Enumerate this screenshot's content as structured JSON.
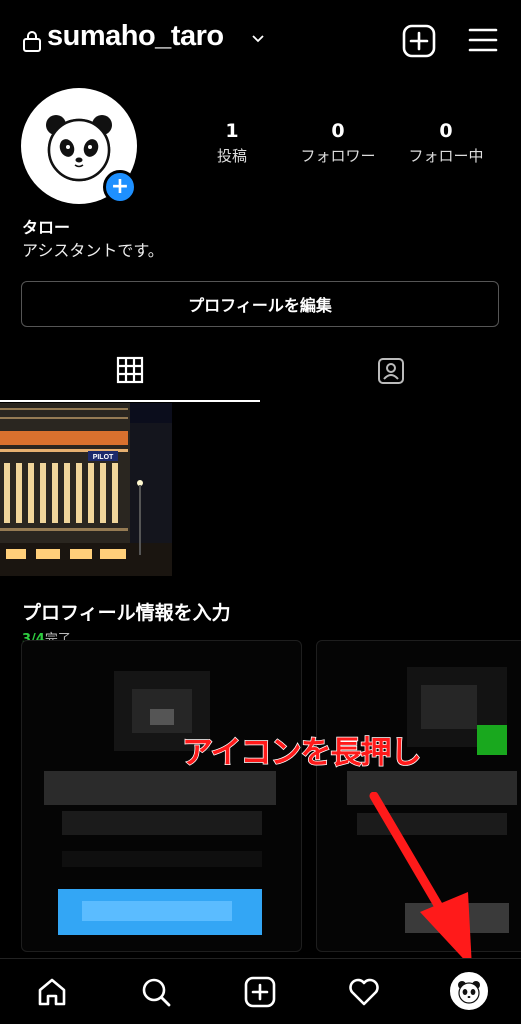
{
  "header": {
    "username": "sumaho_taro",
    "icons": {
      "lock": "lock-icon",
      "chevron": "chevron-down-icon",
      "create": "plus-square-icon",
      "menu": "hamburger-menu-icon"
    }
  },
  "profile": {
    "avatar_icon": "panda-face-icon",
    "display_name": "タロー",
    "bio": "アシスタントです。",
    "stats": [
      {
        "value": "1",
        "label": "投稿"
      },
      {
        "value": "0",
        "label": "フォロワー"
      },
      {
        "value": "0",
        "label": "フォロー中"
      }
    ],
    "edit_button": "プロフィールを編集"
  },
  "tabs": [
    {
      "name": "posts-grid",
      "icon": "grid-icon",
      "active": true
    },
    {
      "name": "tagged",
      "icon": "tagged-person-icon",
      "active": false
    }
  ],
  "posts": [
    {
      "description": "night-building-photo",
      "sign_text": "PILOT"
    }
  ],
  "profile_info": {
    "title": "プロフィール情報を入力",
    "progress_count": "3/4",
    "progress_label": "完了"
  },
  "annotation": {
    "callout_text": "アイコンを長押し",
    "color": "#ff1a1a"
  },
  "bottom_nav": [
    {
      "name": "home",
      "icon": "home-icon"
    },
    {
      "name": "search",
      "icon": "search-icon"
    },
    {
      "name": "create",
      "icon": "plus-square-icon"
    },
    {
      "name": "activity",
      "icon": "heart-icon"
    },
    {
      "name": "profile",
      "icon": "panda-avatar-icon"
    }
  ],
  "colors": {
    "background": "#000000",
    "accent_blue": "#1e90ff",
    "success_green": "#2ecc40",
    "annotation_red": "#ff1a1a"
  }
}
